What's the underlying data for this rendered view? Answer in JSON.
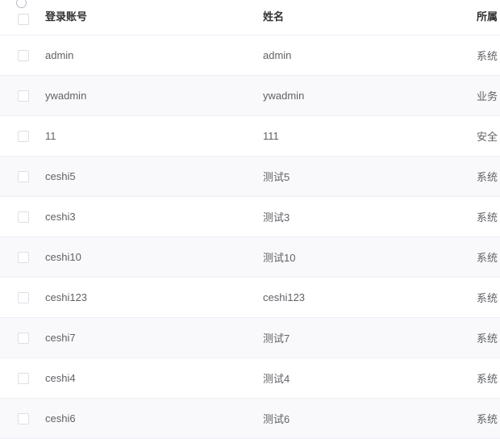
{
  "headers": {
    "login": "登录账号",
    "name": "姓名",
    "dept": "所属"
  },
  "rows": [
    {
      "login": "admin",
      "name": "admin",
      "dept": "系统"
    },
    {
      "login": "ywadmin",
      "name": "ywadmin",
      "dept": "业务"
    },
    {
      "login": "11",
      "name": "111",
      "dept": "安全"
    },
    {
      "login": "ceshi5",
      "name": "测试5",
      "dept": "系统"
    },
    {
      "login": "ceshi3",
      "name": "测试3",
      "dept": "系统"
    },
    {
      "login": "ceshi10",
      "name": "测试10",
      "dept": "系统"
    },
    {
      "login": "ceshi123",
      "name": "ceshi123",
      "dept": "系统"
    },
    {
      "login": "ceshi7",
      "name": "测试7",
      "dept": "系统"
    },
    {
      "login": "ceshi4",
      "name": "测试4",
      "dept": "系统"
    },
    {
      "login": "ceshi6",
      "name": "测试6",
      "dept": "系统"
    }
  ]
}
